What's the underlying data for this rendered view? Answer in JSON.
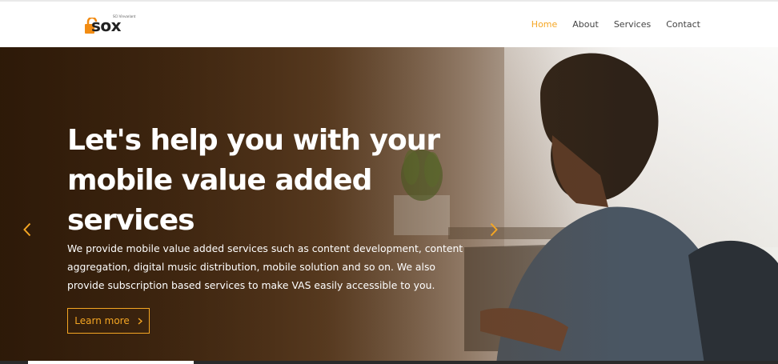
{
  "brand": {
    "name": "sox",
    "tagline": "SCI Vinvariant",
    "logo_icon": "padlock-icon",
    "accent": "#f5a623"
  },
  "nav": {
    "items": [
      {
        "label": "Home",
        "active": true
      },
      {
        "label": "About",
        "active": false
      },
      {
        "label": "Services",
        "active": false
      },
      {
        "label": "Contact",
        "active": false
      }
    ]
  },
  "hero": {
    "headline": "Let's help you with your mobile value added services",
    "description": "We provide mobile value added services such as content development, content aggregation, digital music distribution, mobile solution and so on. We also provide subscription based services to make VAS easily accessible to you.",
    "cta_label": "Learn more",
    "cta_icon": "chevron-right-icon",
    "prev_icon": "chevron-left-icon",
    "next_icon": "chevron-right-icon"
  }
}
